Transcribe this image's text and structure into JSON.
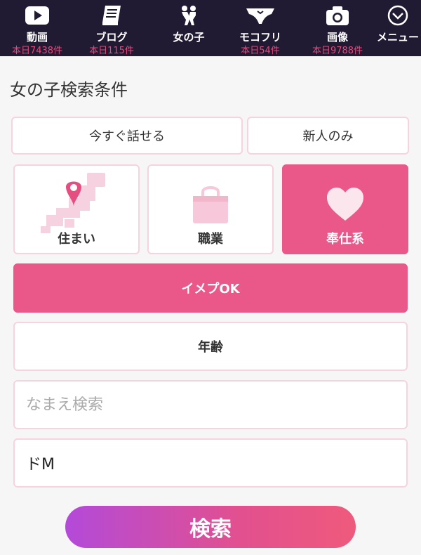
{
  "nav": [
    {
      "label": "動画",
      "count": "本日7438件",
      "icon": "video-play-icon"
    },
    {
      "label": "ブログ",
      "count": "本日115件",
      "icon": "book-icon"
    },
    {
      "label": "女の子",
      "count": "",
      "icon": "couple-icon"
    },
    {
      "label": "モコフリ",
      "count": "本日54件",
      "icon": "underwear-icon"
    },
    {
      "label": "画像",
      "count": "本日9788件",
      "icon": "camera-icon"
    },
    {
      "label": "メニュー",
      "count": "",
      "icon": "chevron-down-circle-icon"
    }
  ],
  "search": {
    "title": "女の子検索条件",
    "now_label": "今すぐ話せる",
    "new_label": "新人のみ",
    "categories": [
      {
        "label": "住まい",
        "icon": "japan-map-pin-icon",
        "selected": false
      },
      {
        "label": "職業",
        "icon": "shopping-bag-icon",
        "selected": false
      },
      {
        "label": "奉仕系",
        "icon": "heart-icon",
        "selected": true
      }
    ],
    "imepu_label": "イメプOK",
    "age_label": "年齢",
    "name_placeholder": "なまえ検索",
    "tag_value": "ドM",
    "submit_label": "検索"
  },
  "colors": {
    "nav_bg": "#201a33",
    "accent": "#ea5789",
    "count_text": "#e8487c",
    "border": "#f6d3df"
  }
}
